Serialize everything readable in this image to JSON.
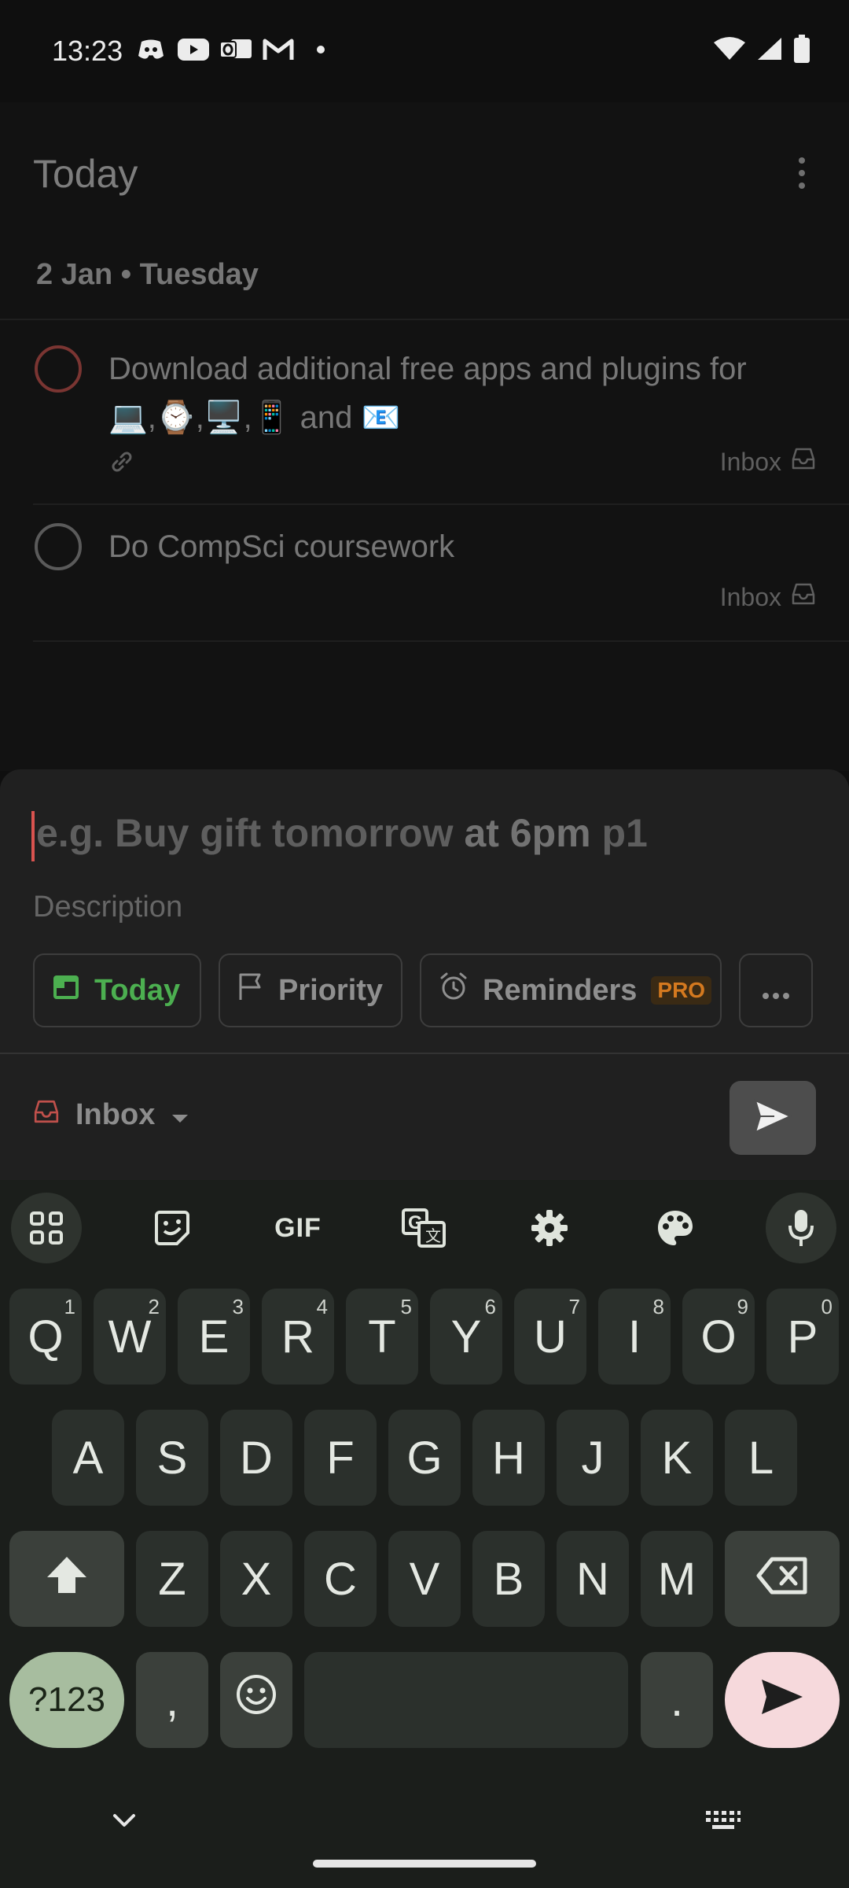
{
  "status_bar": {
    "time": "13:23",
    "left_icons": [
      "discord-icon",
      "youtube-icon",
      "outlook-icon",
      "gmail-icon",
      "notification-dot-icon"
    ],
    "right_icons": [
      "wifi-icon",
      "signal-icon",
      "battery-icon"
    ]
  },
  "header": {
    "title": "Today"
  },
  "date_section": {
    "label": "2 Jan • Tuesday"
  },
  "tasks": [
    {
      "title_line1": "Download additional free apps and plugins for",
      "title_line2": "💻,⌚,🖥️,📱 and 📧",
      "project": "Inbox",
      "priority_color": "#7a3532",
      "has_link": true
    },
    {
      "title_line1": "Do CompSci coursework",
      "project": "Inbox",
      "has_link": false
    }
  ],
  "quick_add": {
    "placeholder_part1": "e.g. Buy gift tomorrow",
    "placeholder_part2": " at 6pm",
    "placeholder_part3": " p1",
    "description_placeholder": "Description",
    "chips": {
      "today": "Today",
      "priority": "Priority",
      "reminders": "Reminders",
      "pro_badge": "PRO"
    },
    "project": "Inbox",
    "accent_color": "#4caf50"
  },
  "keyboard": {
    "toolbar_gif": "GIF",
    "row1": [
      {
        "label": "Q",
        "hint": "1"
      },
      {
        "label": "W",
        "hint": "2"
      },
      {
        "label": "E",
        "hint": "3"
      },
      {
        "label": "R",
        "hint": "4"
      },
      {
        "label": "T",
        "hint": "5"
      },
      {
        "label": "Y",
        "hint": "6"
      },
      {
        "label": "U",
        "hint": "7"
      },
      {
        "label": "I",
        "hint": "8"
      },
      {
        "label": "O",
        "hint": "9"
      },
      {
        "label": "P",
        "hint": "0"
      }
    ],
    "row2": [
      "A",
      "S",
      "D",
      "F",
      "G",
      "H",
      "J",
      "K",
      "L"
    ],
    "row3": [
      "Z",
      "X",
      "C",
      "V",
      "B",
      "N",
      "M"
    ],
    "symbols_label": "?123",
    "comma_label": ",",
    "period_label": "."
  }
}
